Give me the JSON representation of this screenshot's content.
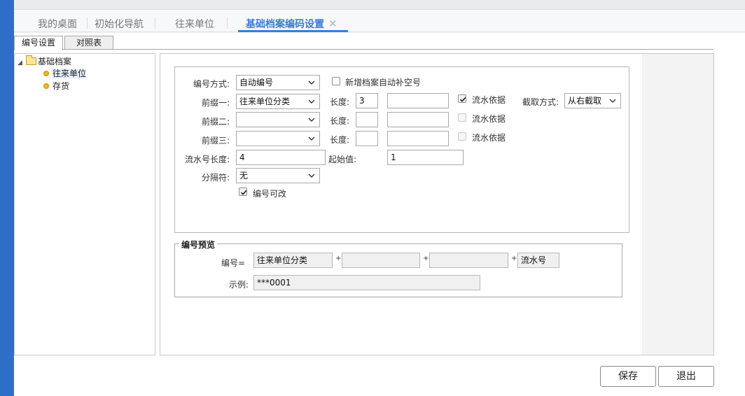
{
  "main_tabs": [
    {
      "label": "我的桌面"
    },
    {
      "label": "初始化导航"
    },
    {
      "label": "往来单位"
    },
    {
      "label": "基础档案编码设置",
      "active": true
    }
  ],
  "sub_tabs": [
    {
      "label": "编号设置",
      "active": true
    },
    {
      "label": "对照表"
    }
  ],
  "tree": {
    "root": "基础档案",
    "children": [
      {
        "label": "往来单位",
        "selected": true
      },
      {
        "label": "存货"
      }
    ]
  },
  "form": {
    "method_label": "编号方式:",
    "method_value": "自动编号",
    "auto_fill_label": "新增档案自动补空号",
    "prefix1_label": "前缀一:",
    "prefix1_value": "往来单位分类",
    "prefix2_label": "前缀二:",
    "prefix2_value": "",
    "prefix3_label": "前缀三:",
    "prefix3_value": "",
    "length_label": "长度:",
    "length1_value": "3",
    "length2_value": "",
    "length3_value": "",
    "basis_label": "流水依据",
    "basis1_checked": true,
    "cut_label": "截取方式:",
    "cut_value": "从右截取",
    "serial_len_label": "流水号长度:",
    "serial_len_value": "4",
    "start_label": "起始值:",
    "start_value": "1",
    "separator_label": "分隔符:",
    "separator_value": "无",
    "editable_label": "编号可改",
    "editable_checked": true
  },
  "preview": {
    "legend": "编号预览",
    "code_label": "编号=",
    "part1": "往来单位分类",
    "part2": "",
    "part3": "",
    "part4": "流水号",
    "plus": "+",
    "example_label": "示例:",
    "example_value": "***0001"
  },
  "buttons": {
    "save": "保存",
    "exit": "退出"
  },
  "colors": {
    "accent": "#3a7dd6",
    "left_strip": "#2d6fc8"
  }
}
